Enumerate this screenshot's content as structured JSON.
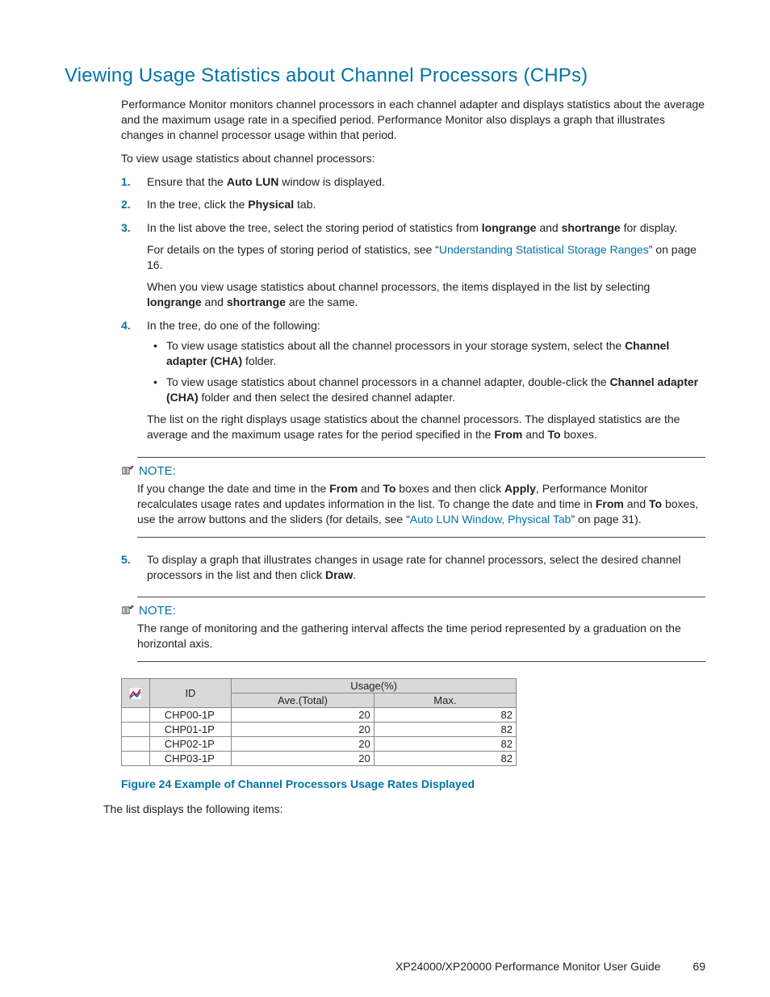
{
  "heading": "Viewing Usage Statistics about Channel Processors (CHPs)",
  "intro1": "Performance Monitor monitors channel processors in each channel adapter and displays statistics about the average and the maximum usage rate in a specified period. Performance Monitor also displays a graph that illustrates changes in channel processor usage within that period.",
  "intro2": "To view usage statistics about channel processors:",
  "steps": {
    "s1": {
      "num": "1.",
      "pre": "Ensure that the ",
      "bold": "Auto LUN",
      "post": " window is displayed."
    },
    "s2": {
      "num": "2.",
      "pre": "In the tree, click the ",
      "bold": "Physical",
      "post": " tab."
    },
    "s3": {
      "num": "3.",
      "line1_pre": "In the list above the tree, select the storing period of statistics from ",
      "line1_b1": "longrange",
      "line1_mid": " and ",
      "line1_b2": "shortrange",
      "line1_post": " for display.",
      "line2_pre": "For details on the types of storing period of statistics, see “",
      "line2_link": "Understanding Statistical Storage Ranges",
      "line2_post": "” on page 16.",
      "line3_pre": "When you view usage statistics about channel processors, the items displayed in the list by selecting ",
      "line3_b1": "longrange",
      "line3_mid": " and ",
      "line3_b2": "shortrange",
      "line3_post": " are the same."
    },
    "s4": {
      "num": "4.",
      "lead": "In the tree, do one of the following:",
      "b1_pre": "To view usage statistics about all the channel processors in your storage system, select the ",
      "b1_bold": "Channel adapter (CHA)",
      "b1_post": " folder.",
      "b2_pre": "To view usage statistics about channel processors in a channel adapter, double-click the ",
      "b2_bold": "Channel adapter (CHA)",
      "b2_post": " folder and then select the desired channel adapter.",
      "trail_pre": "The list on the right displays usage statistics about the channel processors. The displayed statistics are the average and the maximum usage rates for the period specified in the ",
      "trail_b1": "From",
      "trail_mid": " and ",
      "trail_b2": "To",
      "trail_post": " boxes."
    },
    "s5": {
      "num": "5.",
      "pre": "To display a graph that illustrates changes in usage rate for channel processors, select the desired channel processors in the list and then click ",
      "bold": "Draw",
      "post": "."
    }
  },
  "note1": {
    "label": "NOTE:",
    "t1": "If you change the date and time in the ",
    "b1": "From",
    "t2": " and ",
    "b2": "To",
    "t3": " boxes and then click ",
    "b3": "Apply",
    "t4": ", Performance Monitor recalculates usage rates and updates information in the list. To change the date and time in ",
    "b4": "From",
    "t5": " and ",
    "b5": "To",
    "t6": " boxes, use the arrow buttons and the sliders (for details, see “",
    "link": "Auto LUN Window, Physical Tab",
    "t7": "” on page 31)."
  },
  "note2": {
    "label": "NOTE:",
    "text": "The range of monitoring and the gathering interval affects the time period represented by a graduation on the horizontal axis."
  },
  "table": {
    "h_id": "ID",
    "h_usage": "Usage(%)",
    "h_ave": "Ave.(Total)",
    "h_max": "Max.",
    "rows": [
      {
        "id": "CHP00-1P",
        "ave": "20",
        "max": "82"
      },
      {
        "id": "CHP01-1P",
        "ave": "20",
        "max": "82"
      },
      {
        "id": "CHP02-1P",
        "ave": "20",
        "max": "82"
      },
      {
        "id": "CHP03-1P",
        "ave": "20",
        "max": "82"
      }
    ]
  },
  "figure_caption": "Figure 24 Example of Channel Processors Usage Rates Displayed",
  "after_figure": "The list displays the following items:",
  "footer": {
    "title": "XP24000/XP20000 Performance Monitor User Guide",
    "page": "69"
  }
}
